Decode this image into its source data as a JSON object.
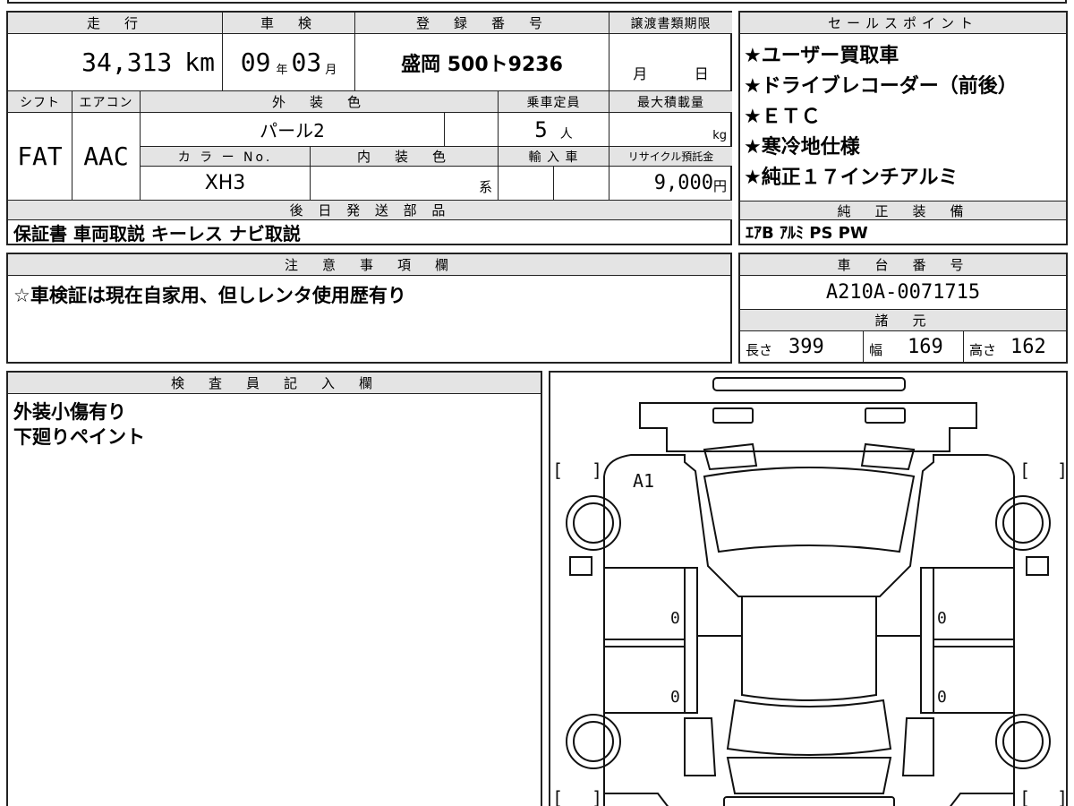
{
  "main_info": {
    "mileage_header": "走　行",
    "mileage_value": "34,313",
    "mileage_unit": "km",
    "inspection_header": "車　検",
    "inspection_year": "09",
    "inspection_year_unit": "年",
    "inspection_month": "03",
    "inspection_month_unit": "月",
    "registration_header": "登　録　番　号",
    "registration_value": "盛岡 500ト9236",
    "transfer_header": "譲渡書類期限",
    "transfer_month_unit": "月",
    "transfer_day_unit": "日",
    "shift_header": "シフト",
    "ac_header": "エアコン",
    "exterior_color_header": "外　装　色",
    "capacity_header": "乗車定員",
    "max_load_header": "最大積載量",
    "shift_value": "FAT",
    "ac_value": "AAC",
    "exterior_color_value": "パール2",
    "capacity_value": "5",
    "capacity_unit": "人",
    "max_load_unit": "kg",
    "color_no_header": "カ ラ ー No.",
    "interior_color_header": "内　装　色",
    "import_header": "輸 入 車",
    "recycle_header": "リサイクル預託金",
    "color_no_value": "XH3",
    "interior_color_unit": "系",
    "recycle_value": "9,000",
    "recycle_unit": "円",
    "later_parts_header": "後 日 発 送 部 品",
    "later_parts_value": "保証書 車両取説 キーレス ナビ取説"
  },
  "sales_points": {
    "header": "セールスポイント",
    "items": [
      "★ユーザー買取車",
      "★ドライブレコーダー（前後）",
      "★ＥＴＣ",
      "★寒冷地仕様",
      "★純正１７インチアルミ"
    ],
    "equipment_header": "純　正　装　備",
    "equipment_value": "ｴｱB ｱﾙﾐ PS PW"
  },
  "notes": {
    "header": "注　意　事　項　欄",
    "value": "☆車検証は現在自家用、但しレンタ使用歴有り"
  },
  "chassis": {
    "header": "車　台　番　号",
    "value": "A210A-0071715",
    "specs_header": "諸　元",
    "length_label": "長さ",
    "length_value": "399",
    "width_label": "幅",
    "width_value": "169",
    "height_label": "高さ",
    "height_value": "162"
  },
  "inspector": {
    "header": "検　査　員　記　入　欄",
    "lines": [
      "外装小傷有り",
      "下廻りペイント"
    ]
  },
  "diagram": {
    "damage_mark": "A1",
    "zero_marks": [
      "0",
      "0",
      "0",
      "0"
    ],
    "bracket_open": "[",
    "bracket_close": "]"
  }
}
